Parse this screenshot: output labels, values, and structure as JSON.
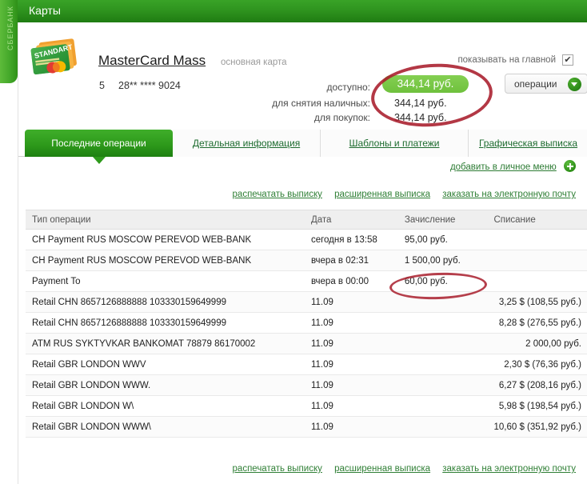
{
  "left_strip": {
    "vertical_text": "СБЕРБАНК"
  },
  "header": {
    "title": "Карты"
  },
  "card": {
    "art_label": "STANDART",
    "name": "MasterCard Mass",
    "subtitle": "основная карта",
    "sequence": "5",
    "number_masked": "28** **** 9024",
    "show_on_main_label": "показывать на главной",
    "show_on_main_checked": "✔",
    "available_label": "доступно:",
    "available_value": "344,14 руб.",
    "cash_label": "для снятия наличных:",
    "cash_value": "344,14 руб.",
    "purchases_label": "для покупок:",
    "purchases_value": "344,14 руб.",
    "operations_button": "операции"
  },
  "tabs": [
    {
      "label": "Последние операции",
      "active": true
    },
    {
      "label": "Детальная информация",
      "active": false
    },
    {
      "label": "Шаблоны и платежи",
      "active": false
    },
    {
      "label": "Графическая выписка",
      "active": false
    }
  ],
  "add_to_menu_link": "добавить в личное меню",
  "statement_links": {
    "print": "распечатать выписку",
    "extended": "расширенная выписка",
    "email": "заказать на электронную почту"
  },
  "table": {
    "columns": [
      "Тип операции",
      "Дата",
      "Зачисление",
      "Списание"
    ],
    "rows": [
      {
        "type": "CH Payment RUS MOSCOW PEREVOD WEB-BANK",
        "date": "сегодня в 13:58",
        "credit": "95,00 руб.",
        "debit": ""
      },
      {
        "type": "CH Payment RUS MOSCOW PEREVOD WEB-BANK",
        "date": "вчера в 02:31",
        "credit": "1 500,00 руб.",
        "debit": ""
      },
      {
        "type": "Payment To",
        "date": "вчера в 00:00",
        "credit": "60,00 руб.",
        "debit": ""
      },
      {
        "type": "Retail CHN 8657126888888 103330159649999",
        "date": "11.09",
        "credit": "",
        "debit": "3,25 $ (108,55 руб.)"
      },
      {
        "type": "Retail CHN 8657126888888 103330159649999",
        "date": "11.09",
        "credit": "",
        "debit": "8,28 $ (276,55 руб.)"
      },
      {
        "type": "ATM RUS SYKTYVKAR BANKOMAT 78879 86170002",
        "date": "11.09",
        "credit": "",
        "debit": "2 000,00 руб."
      },
      {
        "type": "Retail GBR LONDON WWV",
        "date": "11.09",
        "credit": "",
        "debit": "2,30 $ (76,36 руб.)"
      },
      {
        "type": "Retail GBR LONDON WWW.",
        "date": "11.09",
        "credit": "",
        "debit": "6,27 $ (208,16 руб.)"
      },
      {
        "type": "Retail GBR LONDON W\\",
        "date": "11.09",
        "credit": "",
        "debit": "5,98 $ (198,54 руб.)"
      },
      {
        "type": "Retail GBR LONDON WWW\\",
        "date": "11.09",
        "credit": "",
        "debit": "10,60 $ (351,92 руб.)"
      }
    ]
  },
  "annotations": {
    "ellipse_balance_color": "#a81d2b",
    "ellipse_amount_color": "#a81d2b"
  },
  "colors": {
    "brand_green": "#2e9a1b",
    "header_green": "#2f941f",
    "pill_green": "#6fc13d",
    "link_green": "#2f7f35"
  }
}
